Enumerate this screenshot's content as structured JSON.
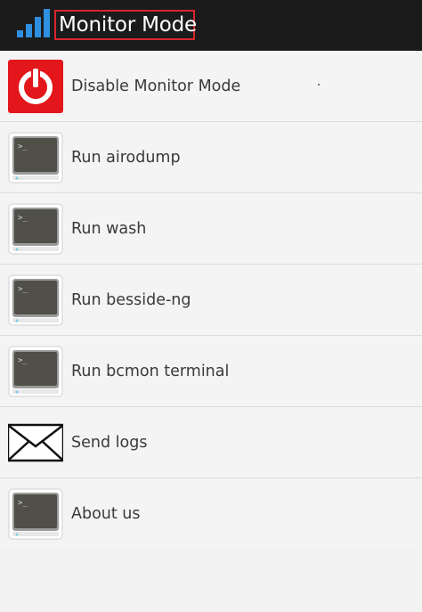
{
  "app_bar": {
    "title": "Monitor Mode",
    "icon": "signal-bars-icon"
  },
  "menu": {
    "items": [
      {
        "label": "Disable Monitor Mode",
        "icon": "power-icon"
      },
      {
        "label": "Run airodump",
        "icon": "terminal-icon"
      },
      {
        "label": "Run wash",
        "icon": "terminal-icon"
      },
      {
        "label": "Run besside-ng",
        "icon": "terminal-icon"
      },
      {
        "label": "Run bcmon terminal",
        "icon": "terminal-icon"
      },
      {
        "label": "Send logs",
        "icon": "envelope-icon"
      },
      {
        "label": "About us",
        "icon": "terminal-icon"
      }
    ]
  },
  "colors": {
    "app_bar_bg": "#1b1b1b",
    "title_highlight": "#d9252f",
    "signal_icon": "#2f8fe0",
    "power_button": "#e3171b"
  }
}
